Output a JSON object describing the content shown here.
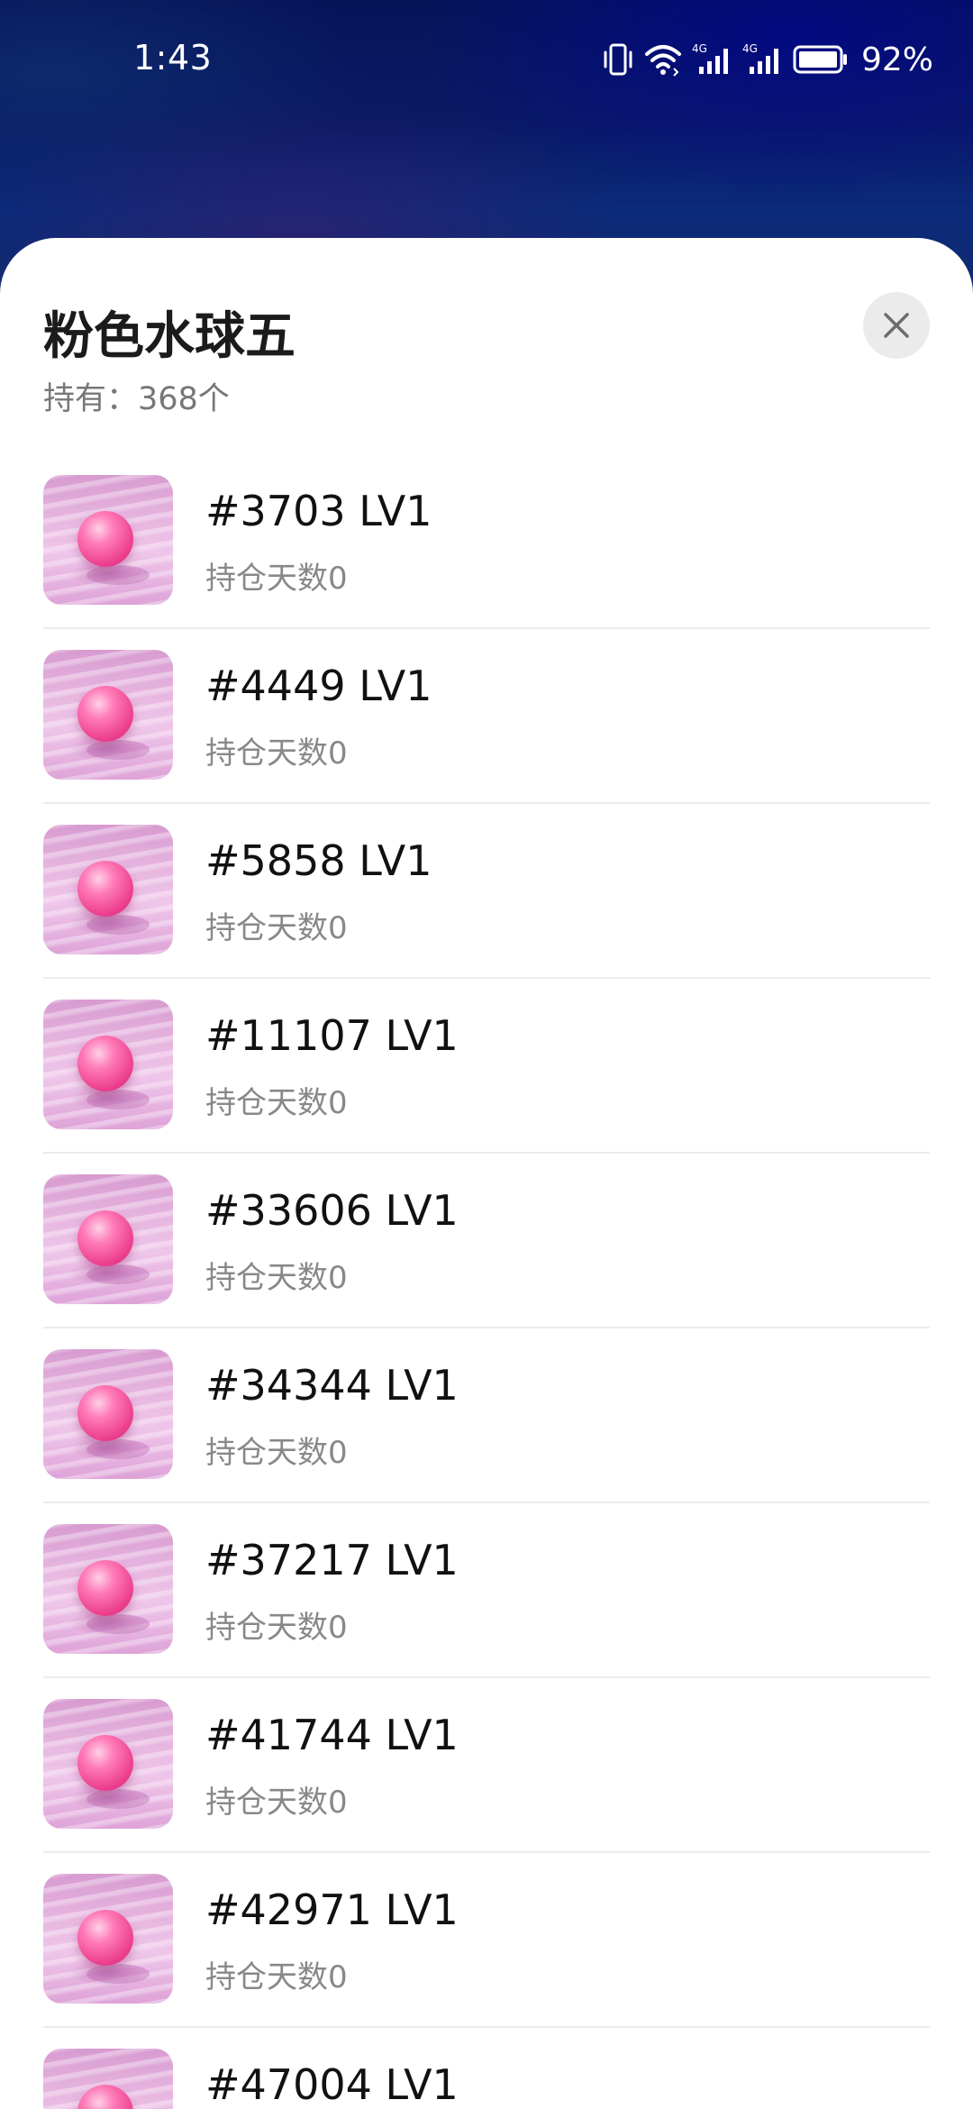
{
  "status_bar": {
    "time": "1:43",
    "battery": "92%",
    "icons": [
      "vibrate-icon",
      "wifi-icon",
      "signal-4g-icon",
      "signal-4g-icon",
      "battery-icon"
    ]
  },
  "sheet": {
    "title": "粉色水球五",
    "holding": "持有：368个",
    "close_icon": "close-icon"
  },
  "items": [
    {
      "title": "#3703 LV1",
      "days": "持仓天数0"
    },
    {
      "title": "#4449 LV1",
      "days": "持仓天数0"
    },
    {
      "title": "#5858 LV1",
      "days": "持仓天数0"
    },
    {
      "title": "#11107 LV1",
      "days": "持仓天数0"
    },
    {
      "title": "#33606 LV1",
      "days": "持仓天数0"
    },
    {
      "title": "#34344 LV1",
      "days": "持仓天数0"
    },
    {
      "title": "#37217 LV1",
      "days": "持仓天数0"
    },
    {
      "title": "#41744 LV1",
      "days": "持仓天数0"
    },
    {
      "title": "#42971 LV1",
      "days": "持仓天数0"
    },
    {
      "title": "#47004 LV1",
      "days": ""
    }
  ]
}
